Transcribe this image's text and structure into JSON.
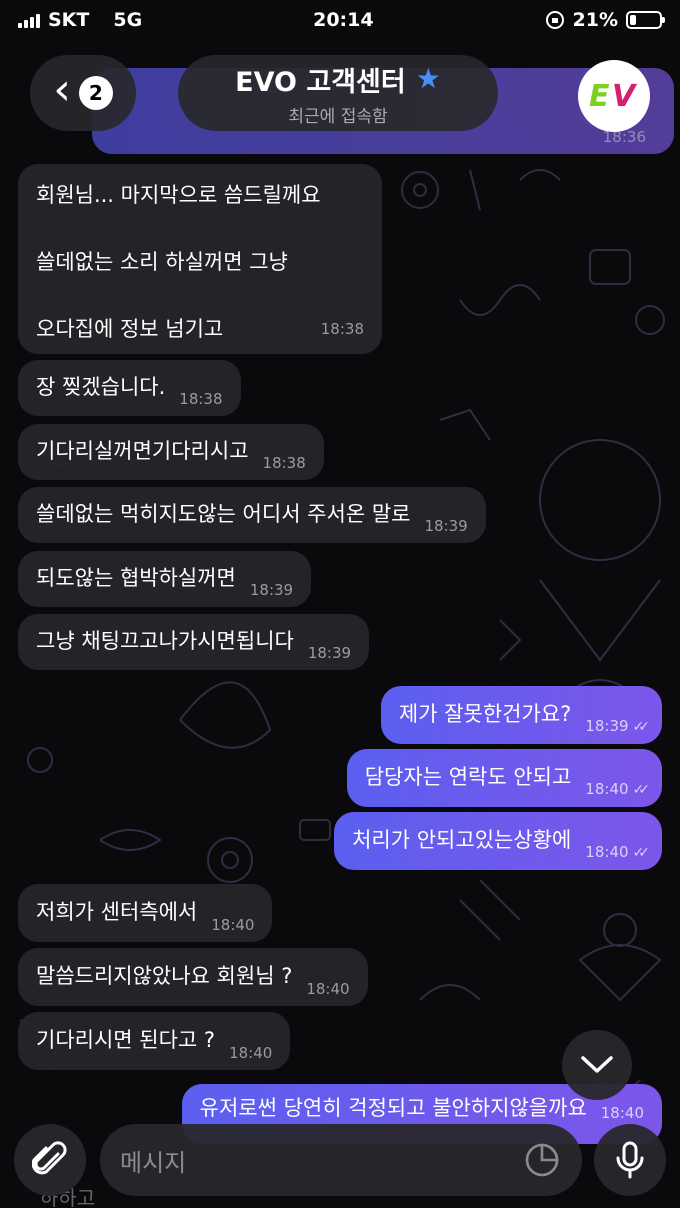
{
  "status_bar": {
    "carrier": "SKT",
    "network": "5G",
    "time": "20:14",
    "battery": "21%",
    "battery_level": 0.21
  },
  "header": {
    "back_count": "2",
    "title": "EVO 고객센터",
    "subtitle": "최근에 접속함",
    "avatar_text": "EV"
  },
  "top_partial_message": {
    "time": "18:36"
  },
  "messages": [
    {
      "dir": "in",
      "lines": [
        "회원님... 마지막으로 씀드릴께요",
        "쓸데없는 소리 하실꺼면 그냥",
        "오다집에 정보 넘기고"
      ],
      "time": "18:38"
    },
    {
      "dir": "in",
      "text": "장 찢겠습니다.",
      "time": "18:38"
    },
    {
      "dir": "in",
      "text": "기다리실꺼면기다리시고",
      "time": "18:38"
    },
    {
      "dir": "in",
      "text": "쓸데없는 먹히지도않는 어디서 주서온 말로",
      "time": "18:39"
    },
    {
      "dir": "in",
      "text": "되도않는 협박하실꺼면",
      "time": "18:39"
    },
    {
      "dir": "in",
      "text": "그냥 채팅끄고나가시면됩니다",
      "time": "18:39"
    },
    {
      "dir": "out",
      "text": "제가 잘못한건가요?",
      "time": "18:39"
    },
    {
      "dir": "out",
      "text": "담당자는 연락도 안되고",
      "time": "18:40"
    },
    {
      "dir": "out",
      "text": "처리가 안되고있는상황에",
      "time": "18:40"
    },
    {
      "dir": "in",
      "text": "저희가 센터측에서",
      "time": "18:40"
    },
    {
      "dir": "in",
      "text": "말씀드리지않았나요 회원님 ?",
      "time": "18:40"
    },
    {
      "dir": "in",
      "text": "기다리시면 된다고 ?",
      "time": "18:40"
    },
    {
      "dir": "out",
      "text": "유저로썬 당연히 걱정되고 불안하지않을까요",
      "time": "18:40"
    }
  ],
  "input": {
    "placeholder": "메시지"
  },
  "behind_input_text": "하하고",
  "colors": {
    "background": "#0a0a0c",
    "incoming_bubble": "#26262a",
    "outgoing_start": "#5b5ff0",
    "outgoing_end": "#7d56ea",
    "star": "#4a8ef5"
  },
  "icons": {
    "back": "chevron-left-icon",
    "star": "star-icon",
    "scroll": "chevron-down-icon",
    "attach": "paperclip-icon",
    "sticker": "sticker-icon",
    "mic": "microphone-icon"
  }
}
